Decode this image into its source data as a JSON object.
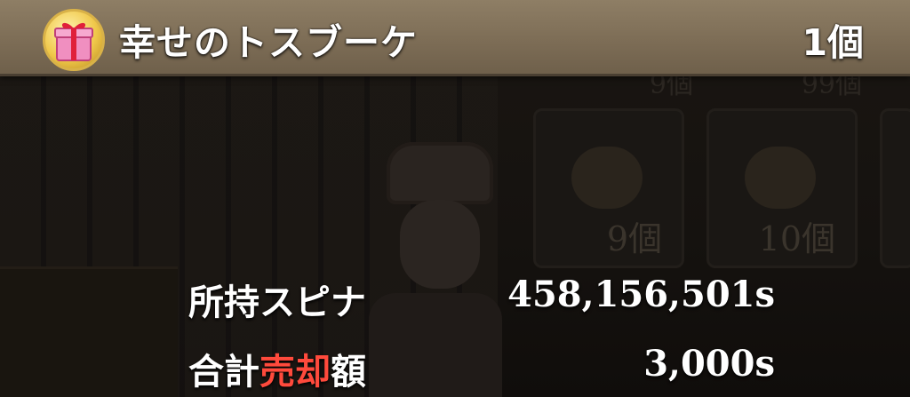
{
  "item": {
    "name": "幸せのトスブーケ",
    "count": "1個",
    "icon": "gift-box-icon"
  },
  "background": {
    "tile_counts_top": [
      "9個",
      "99個"
    ],
    "tile_counts": [
      "9個",
      "10個"
    ]
  },
  "summary": {
    "owned_label": "所持スピナ",
    "owned_value": "458,156,501s",
    "total_label_prefix": "合計",
    "total_label_highlight": "売却",
    "total_label_suffix": "額",
    "total_value": "3,000s"
  },
  "colors": {
    "header_bar": "#8e7e65",
    "highlight_red": "#ff4a3c",
    "text": "#ffffff"
  }
}
